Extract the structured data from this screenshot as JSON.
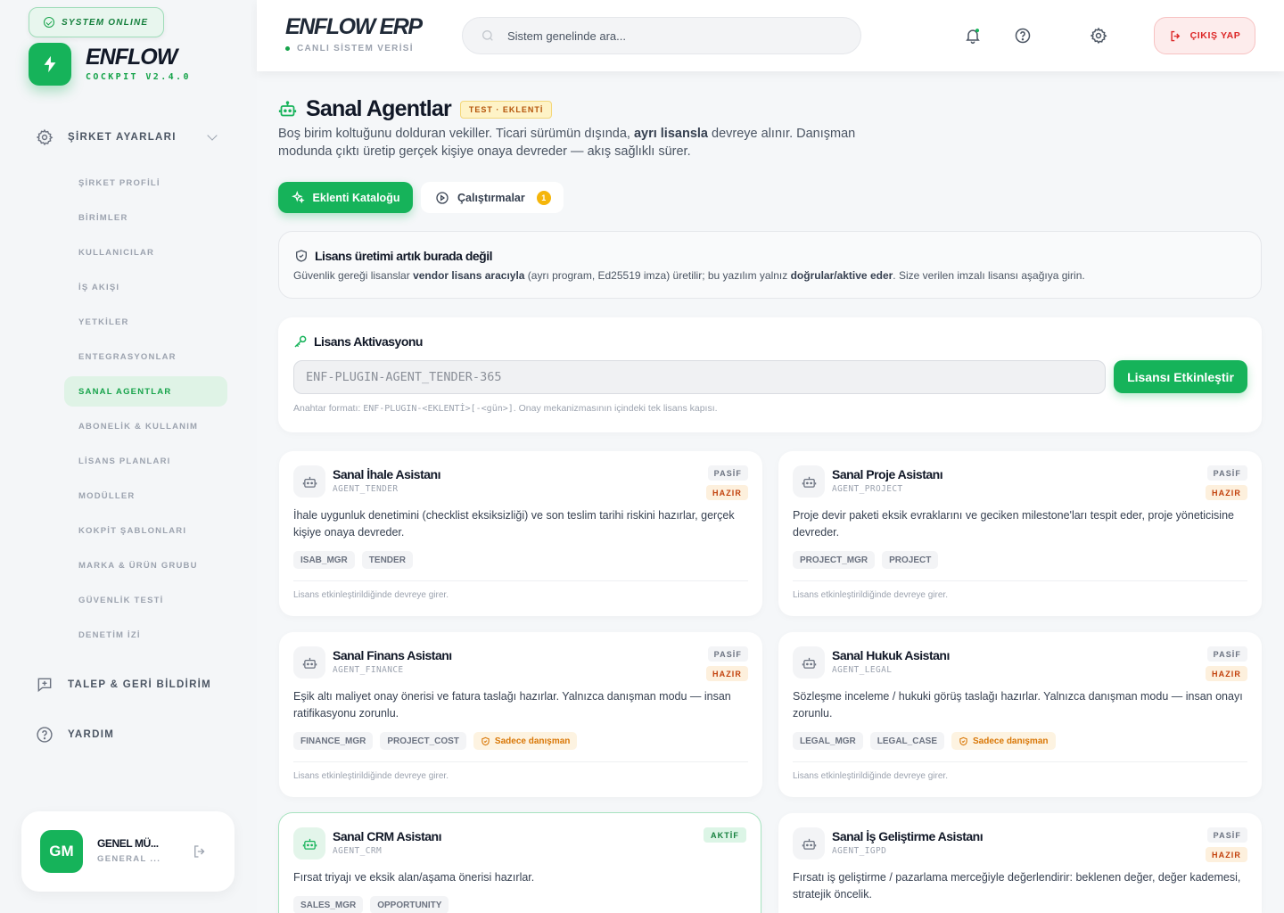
{
  "sidebar": {
    "status_badge": "SYSTEM ONLINE",
    "brand": "ENFLOW",
    "brand_sub": "COCKPIT V2.4.0",
    "group_label": "ŞİRKET AYARLARI",
    "items": [
      {
        "label": "ŞİRKET PROFİLİ",
        "key": "sirket-profili"
      },
      {
        "label": "BİRİMLER",
        "key": "birimler"
      },
      {
        "label": "KULLANICILAR",
        "key": "kullanicilar"
      },
      {
        "label": "İŞ AKIŞI",
        "key": "is-akisi"
      },
      {
        "label": "YETKİLER",
        "key": "yetkiler"
      },
      {
        "label": "ENTEGRASYONLAR",
        "key": "entegrasyonlar"
      },
      {
        "label": "SANAL AGENTLAR",
        "key": "sanal-agentlar",
        "active": true
      },
      {
        "label": "ABONELİK & KULLANIM",
        "key": "abonelik"
      },
      {
        "label": "LİSANS PLANLARI",
        "key": "lisans-planlari"
      },
      {
        "label": "MODÜLLER",
        "key": "moduller"
      },
      {
        "label": "KOKPİT ŞABLONLARI",
        "key": "kokpit-sablonlari"
      },
      {
        "label": "MARKA & ÜRÜN GRUBU",
        "key": "marka-urun"
      },
      {
        "label": "GÜVENLİK TESTİ",
        "key": "guvenlik-testi"
      },
      {
        "label": "DENETİM İZİ",
        "key": "denetim-izi"
      }
    ],
    "feedback_label": "TALEP & GERİ BİLDİRİM",
    "help_label": "YARDIM",
    "user": {
      "initials": "GM",
      "name": "GENEL MÜ...",
      "role": "GENERAL ..."
    }
  },
  "header": {
    "title": "ENFLOW ERP",
    "subtitle": "CANLI SİSTEM VERİSİ",
    "search_placeholder": "Sistem genelinde ara...",
    "logout_label": "ÇIKIŞ YAP"
  },
  "page": {
    "title": "Sanal Agentlar",
    "badge": "TEST · EKLENTİ",
    "desc_1": "Boş birim koltuğunu dolduran vekiller. Ticari sürümün dışında, ",
    "desc_bold": "ayrı lisansla",
    "desc_2": " devreye alınır. Danışman modunda çıktı üretip gerçek kişiye onaya devreder — akış sağlıklı sürer.",
    "tab_catalog": "Eklenti Kataloğu",
    "tab_runs": "Çalıştırmalar",
    "runs_count": "1"
  },
  "info": {
    "title": "Lisans üretimi artık burada değil",
    "t1": "Güvenlik gereği lisanslar ",
    "b1": "vendor lisans aracıyla",
    "t2": " (ayrı program, Ed25519 imza) üretilir; bu yazılım yalnız ",
    "b2": "doğrular/aktive eder",
    "t3": ". Size verilen imzalı lisansı aşağıya girin."
  },
  "license": {
    "title": "Lisans Aktivasyonu",
    "placeholder": "ENF-PLUGIN-AGENT_TENDER-365",
    "button": "Lisansı Etkinleştir",
    "hint_1": "Anahtar formatı: ",
    "hint_code": "ENF-PLUGIN-<EKLENTİ>[-<gün>]",
    "hint_2": ". Onay mekanizmasının içindeki tek lisans kapısı."
  },
  "agents": [
    {
      "name": "Sanal İhale Asistanı",
      "code": "AGENT_TENDER",
      "status": "PASİF",
      "state": "HAZIR",
      "desc": "İhale uygunluk denetimini (checklist eksiksizliği) ve son teslim tarihi riskini hazırlar, gerçek kişiye onaya devreder.",
      "tags": [
        "ISAB_MGR",
        "TENDER"
      ],
      "warn": "",
      "footer": "Lisans etkinleştirildiğinde devreye girer."
    },
    {
      "name": "Sanal Proje Asistanı",
      "code": "AGENT_PROJECT",
      "status": "PASİF",
      "state": "HAZIR",
      "desc": "Proje devir paketi eksik evraklarını ve geciken milestone'ları tespit eder, proje yöneticisine devreder.",
      "tags": [
        "PROJECT_MGR",
        "PROJECT"
      ],
      "warn": "",
      "footer": "Lisans etkinleştirildiğinde devreye girer."
    },
    {
      "name": "Sanal Finans Asistanı",
      "code": "AGENT_FINANCE",
      "status": "PASİF",
      "state": "HAZIR",
      "desc": "Eşik altı maliyet onay önerisi ve fatura taslağı hazırlar. Yalnızca danışman modu — insan ratifikasyonu zorunlu.",
      "tags": [
        "FINANCE_MGR",
        "PROJECT_COST"
      ],
      "warn": "Sadece danışman",
      "footer": "Lisans etkinleştirildiğinde devreye girer."
    },
    {
      "name": "Sanal Hukuk Asistanı",
      "code": "AGENT_LEGAL",
      "status": "PASİF",
      "state": "HAZIR",
      "desc": "Sözleşme inceleme / hukuki görüş taslağı hazırlar. Yalnızca danışman modu — insan onayı zorunlu.",
      "tags": [
        "LEGAL_MGR",
        "LEGAL_CASE"
      ],
      "warn": "Sadece danışman",
      "footer": "Lisans etkinleştirildiğinde devreye girer."
    },
    {
      "name": "Sanal CRM Asistanı",
      "code": "AGENT_CRM",
      "status": "AKTİF",
      "state": "",
      "desc": "Fırsat triyajı ve eksik alan/aşama önerisi hazırlar.",
      "tags": [
        "SALES_MGR",
        "OPPORTUNITY"
      ],
      "warn": "",
      "footer": ""
    },
    {
      "name": "Sanal İş Geliştirme Asistanı",
      "code": "AGENT_IGPD",
      "status": "PASİF",
      "state": "HAZIR",
      "desc": "Fırsatı iş geliştirme / pazarlama merceğiyle değerlendirir: beklenen değer, değer kademesi, stratejik öncelik.",
      "tags": [],
      "warn": "",
      "footer": ""
    }
  ],
  "colors": {
    "accent": "#16b35a",
    "danger": "#dc2626",
    "warn": "#d97706"
  }
}
